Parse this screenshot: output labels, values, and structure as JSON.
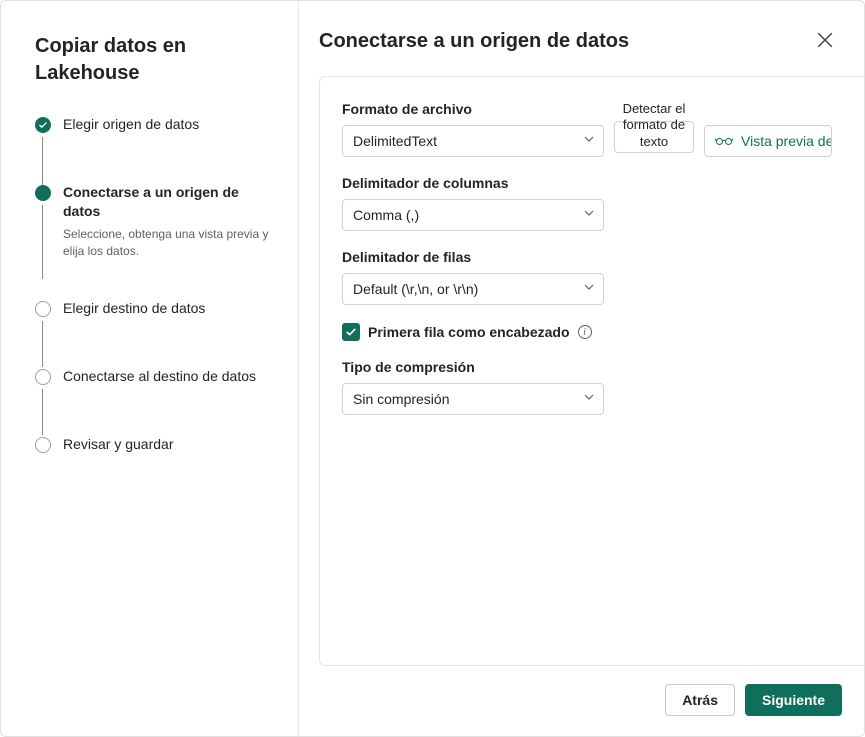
{
  "sidebar": {
    "title": "Copiar datos en Lakehouse",
    "steps": [
      {
        "label": "Elegir origen de datos",
        "state": "completed"
      },
      {
        "label": "Conectarse a un origen de datos",
        "desc": "Seleccione, obtenga una vista previa y elija los datos.",
        "state": "current"
      },
      {
        "label": "Elegir destino de datos",
        "state": "pending"
      },
      {
        "label": "Conectarse al destino de datos",
        "state": "pending"
      },
      {
        "label": "Revisar y guardar",
        "state": "pending"
      }
    ]
  },
  "main": {
    "title": "Conectarse a un origen de datos",
    "form": {
      "file_format_label": "Formato de archivo",
      "file_format_value": "DelimitedText",
      "detect_label": "Detectar el formato de texto",
      "preview_label": "Vista previa de los datos",
      "col_delim_label": "Delimitador de columnas",
      "col_delim_value": "Comma (,)",
      "row_delim_label": "Delimitador de filas",
      "row_delim_value": "Default (\\r,\\n, or \\r\\n)",
      "first_row_header_label": "Primera fila como encabezado",
      "first_row_header_checked": true,
      "compression_label": "Tipo de compresión",
      "compression_value": "Sin compresión"
    }
  },
  "footer": {
    "back": "Atrás",
    "next": "Siguiente"
  }
}
